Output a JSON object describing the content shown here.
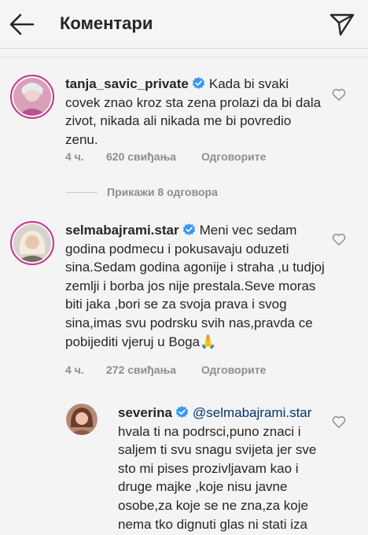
{
  "header": {
    "title": "Коментари",
    "back_icon": "arrow-left-icon",
    "send_icon": "paper-plane-icon"
  },
  "comments": [
    {
      "username": "tanja_savic_private",
      "verified": true,
      "text": "Kada bi svaki covek znao kroz sta zena prolazi da bi dala zivot, nikada ali nikada me bi povredio zenu.",
      "time": "4 ч.",
      "likes": "620 свиђања",
      "reply": "Одговорите"
    },
    {
      "username": "selmabajrami.star",
      "verified": true,
      "text": "Meni vec sedam godina podmecu i pokusavaju oduzeti sina.Sedam godina agonije i straha ,u tudjoj zemlji i borba jos nije prestala.Seve moras biti jaka ,bori se za svoja prava i svog sina,imas svu podrsku svih nas,pravda ce pobijediti vjeruj u Boga🙏",
      "time": "4 ч.",
      "likes": "272 свиђања",
      "reply": "Одговорите"
    }
  ],
  "view_replies": "Прикажи 8 одговора",
  "reply_comment": {
    "username": "severina",
    "verified": true,
    "mention": "@selmabajrami.star",
    "text": "hvala ti na podrsci,puno znaci i saljem ti svu snagu svijeta jer sve sto mi pises prozivljavam kao i druge majke ,koje nisu javne osobe,za koje se ne zna,za koje nema tko dignuti glas ni stati iza njih"
  },
  "colors": {
    "verified": "#3897f0",
    "secondary_text": "#8e8e8e",
    "mention": "#00376b",
    "story_ring": "#c9338e"
  }
}
